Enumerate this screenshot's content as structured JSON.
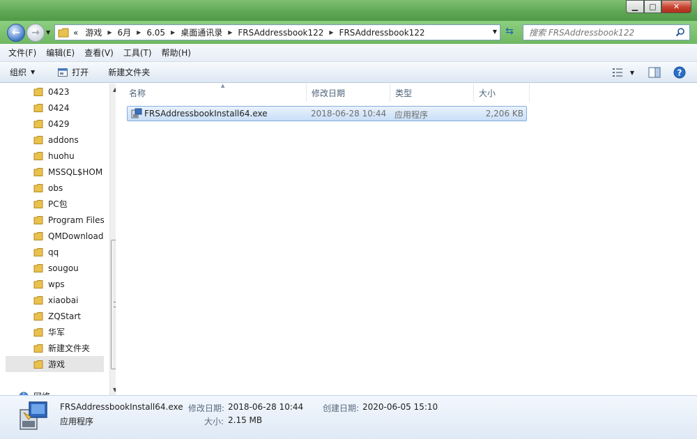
{
  "addressbar": {
    "breadcrumbs": [
      "游戏",
      "6月",
      "6.05",
      "桌面通讯录",
      "FRSAddressbook122",
      "FRSAddressbook122"
    ],
    "search_placeholder": "搜索 FRSAddressbook122"
  },
  "menubar": {
    "items": [
      "文件(F)",
      "编辑(E)",
      "查看(V)",
      "工具(T)",
      "帮助(H)"
    ]
  },
  "toolbar": {
    "organize": "组织",
    "open": "打开",
    "new_folder": "新建文件夹"
  },
  "navpane": {
    "folders": [
      "0423",
      "0424",
      "0429",
      "addons",
      "huohu",
      "MSSQL$HOM",
      "obs",
      "PC包",
      "Program Files",
      "QMDownload",
      "qq",
      "sougou",
      "wps",
      "xiaobai",
      "ZQStart",
      "华军",
      "新建文件夹",
      "游戏"
    ],
    "selected": "游戏",
    "network_label": "网络"
  },
  "filelist": {
    "columns": {
      "name": "名称",
      "modified": "修改日期",
      "type": "类型",
      "size": "大小"
    },
    "rows": [
      {
        "name": "FRSAddressbookInstall64.exe",
        "modified": "2018-06-28 10:44",
        "type": "应用程序",
        "size": "2,206 KB"
      }
    ]
  },
  "details": {
    "filename": "FRSAddressbookInstall64.exe",
    "filetype": "应用程序",
    "modified_label": "修改日期:",
    "modified_value": "2018-06-28 10:44",
    "size_label": "大小:",
    "size_value": "2.15 MB",
    "created_label": "创建日期:",
    "created_value": "2020-06-05 15:10"
  },
  "colors": {
    "titlebar": "#5ea653",
    "selection_border": "#84acdd",
    "selection_fill": "#c8def7",
    "folder": "#e8c14e"
  }
}
